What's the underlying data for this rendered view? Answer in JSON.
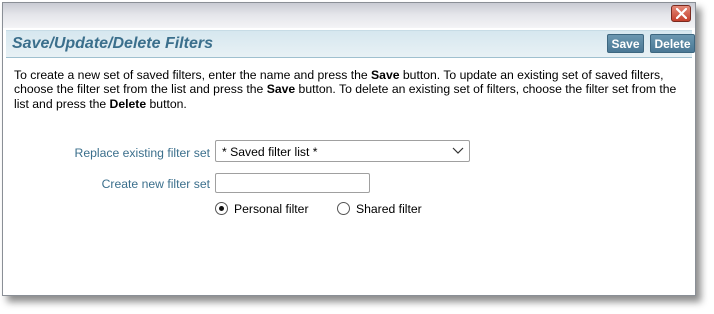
{
  "dialog": {
    "title": "Save/Update/Delete Filters",
    "save_label": "Save",
    "delete_label": "Delete",
    "close_icon": "close-icon",
    "close_color": "#c4402c",
    "accent": "#3b6f8c"
  },
  "description": {
    "part1": "To create a new set of saved filters, enter the name and press the ",
    "save_word": "Save",
    "part2": " button. To update an existing set of saved filters, choose the filter set from the list and press the ",
    "save_word2": "Save",
    "part3": " button. To delete an existing set of filters, choose the filter set from the list and press the ",
    "delete_word": "Delete",
    "part4": " button."
  },
  "form": {
    "replace_label": "Replace existing filter set",
    "replace_selected": "* Saved filter list *",
    "create_label": "Create new filter set",
    "create_value": "",
    "radio_personal": "Personal filter",
    "radio_shared": "Shared filter",
    "selected_radio": "personal"
  }
}
